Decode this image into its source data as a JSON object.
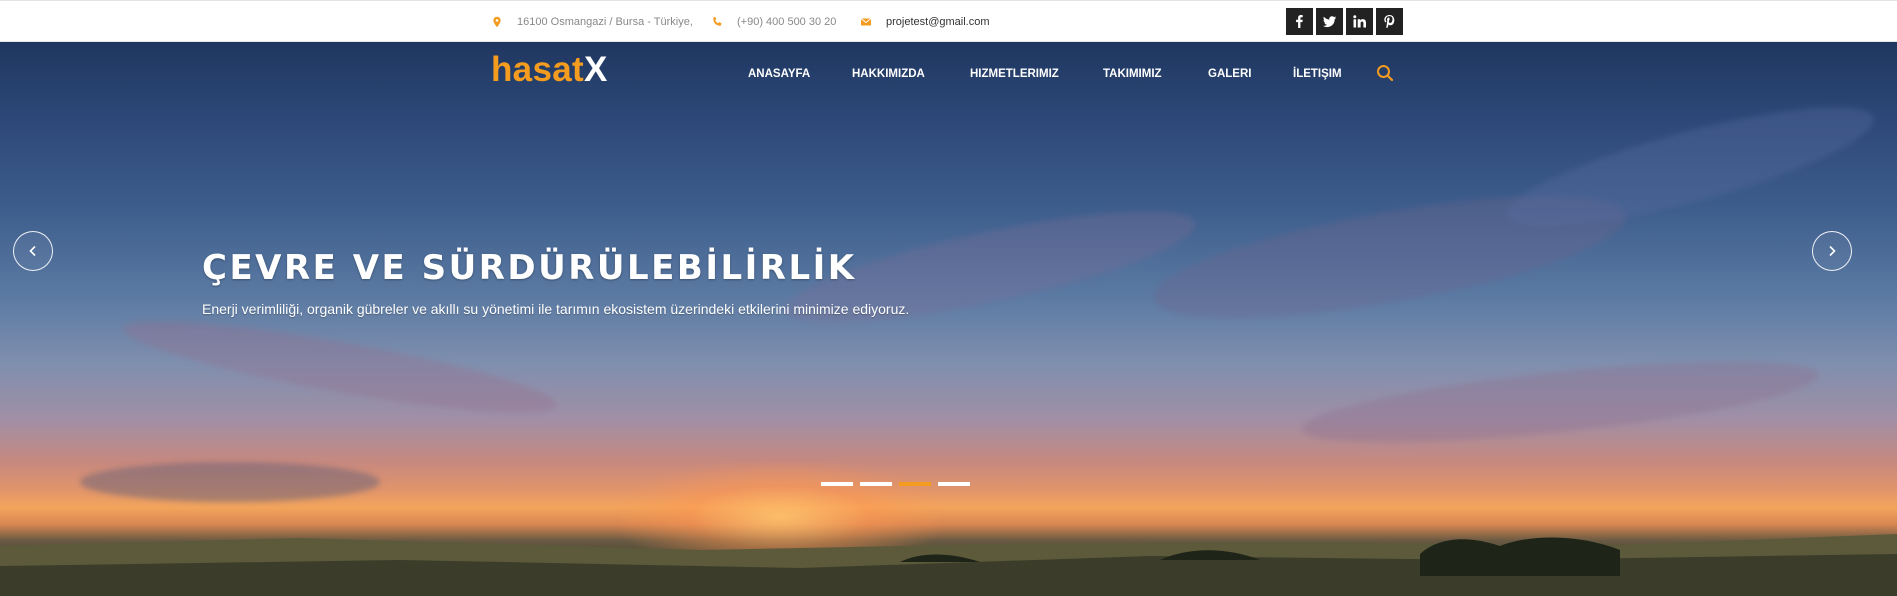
{
  "topbar": {
    "address": "16100 Osmangazi / Bursa - Türkiye,",
    "phone": "(+90) 400 500 30 20",
    "email": "projetest@gmail.com",
    "social": [
      {
        "icon": "facebook-icon"
      },
      {
        "icon": "twitter-icon"
      },
      {
        "icon": "linkedin-icon"
      },
      {
        "icon": "pinterest-icon"
      }
    ]
  },
  "header": {
    "logo_part1": "hasat",
    "logo_part2": "X",
    "nav": [
      "ANASAYFA",
      "HAKKIMIZDA",
      "HIZMETLERIMIZ",
      "TAKIMIMIZ",
      "GALERI",
      "İLETIŞIM"
    ]
  },
  "slider": {
    "title": "ÇEVRE VE SÜRDÜRÜLEBİLİRLİK",
    "text": "Enerji verimliliği, organik gübreler ve akıllı su yönetimi ile tarımın ekosistem üzerindeki etkilerini minimize ediyoruz.",
    "slide_count": 4,
    "active_slide": 3
  },
  "colors": {
    "accent": "#f39c1f",
    "social_bg": "#222222"
  }
}
